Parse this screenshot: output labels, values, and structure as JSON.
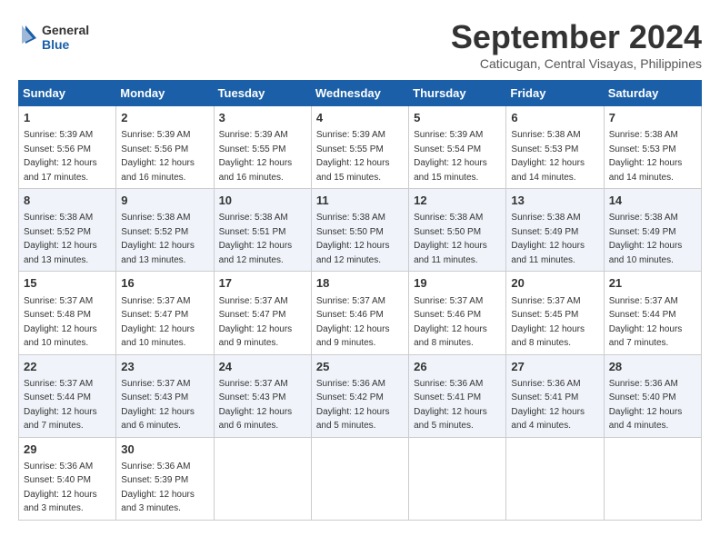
{
  "header": {
    "logo_line1": "General",
    "logo_line2": "Blue",
    "month": "September 2024",
    "location": "Caticugan, Central Visayas, Philippines"
  },
  "weekdays": [
    "Sunday",
    "Monday",
    "Tuesday",
    "Wednesday",
    "Thursday",
    "Friday",
    "Saturday"
  ],
  "weeks": [
    [
      {
        "day": "1",
        "sunrise": "Sunrise: 5:39 AM",
        "sunset": "Sunset: 5:56 PM",
        "daylight": "Daylight: 12 hours and 17 minutes."
      },
      {
        "day": "2",
        "sunrise": "Sunrise: 5:39 AM",
        "sunset": "Sunset: 5:56 PM",
        "daylight": "Daylight: 12 hours and 16 minutes."
      },
      {
        "day": "3",
        "sunrise": "Sunrise: 5:39 AM",
        "sunset": "Sunset: 5:55 PM",
        "daylight": "Daylight: 12 hours and 16 minutes."
      },
      {
        "day": "4",
        "sunrise": "Sunrise: 5:39 AM",
        "sunset": "Sunset: 5:55 PM",
        "daylight": "Daylight: 12 hours and 15 minutes."
      },
      {
        "day": "5",
        "sunrise": "Sunrise: 5:39 AM",
        "sunset": "Sunset: 5:54 PM",
        "daylight": "Daylight: 12 hours and 15 minutes."
      },
      {
        "day": "6",
        "sunrise": "Sunrise: 5:38 AM",
        "sunset": "Sunset: 5:53 PM",
        "daylight": "Daylight: 12 hours and 14 minutes."
      },
      {
        "day": "7",
        "sunrise": "Sunrise: 5:38 AM",
        "sunset": "Sunset: 5:53 PM",
        "daylight": "Daylight: 12 hours and 14 minutes."
      }
    ],
    [
      {
        "day": "8",
        "sunrise": "Sunrise: 5:38 AM",
        "sunset": "Sunset: 5:52 PM",
        "daylight": "Daylight: 12 hours and 13 minutes."
      },
      {
        "day": "9",
        "sunrise": "Sunrise: 5:38 AM",
        "sunset": "Sunset: 5:52 PM",
        "daylight": "Daylight: 12 hours and 13 minutes."
      },
      {
        "day": "10",
        "sunrise": "Sunrise: 5:38 AM",
        "sunset": "Sunset: 5:51 PM",
        "daylight": "Daylight: 12 hours and 12 minutes."
      },
      {
        "day": "11",
        "sunrise": "Sunrise: 5:38 AM",
        "sunset": "Sunset: 5:50 PM",
        "daylight": "Daylight: 12 hours and 12 minutes."
      },
      {
        "day": "12",
        "sunrise": "Sunrise: 5:38 AM",
        "sunset": "Sunset: 5:50 PM",
        "daylight": "Daylight: 12 hours and 11 minutes."
      },
      {
        "day": "13",
        "sunrise": "Sunrise: 5:38 AM",
        "sunset": "Sunset: 5:49 PM",
        "daylight": "Daylight: 12 hours and 11 minutes."
      },
      {
        "day": "14",
        "sunrise": "Sunrise: 5:38 AM",
        "sunset": "Sunset: 5:49 PM",
        "daylight": "Daylight: 12 hours and 10 minutes."
      }
    ],
    [
      {
        "day": "15",
        "sunrise": "Sunrise: 5:37 AM",
        "sunset": "Sunset: 5:48 PM",
        "daylight": "Daylight: 12 hours and 10 minutes."
      },
      {
        "day": "16",
        "sunrise": "Sunrise: 5:37 AM",
        "sunset": "Sunset: 5:47 PM",
        "daylight": "Daylight: 12 hours and 10 minutes."
      },
      {
        "day": "17",
        "sunrise": "Sunrise: 5:37 AM",
        "sunset": "Sunset: 5:47 PM",
        "daylight": "Daylight: 12 hours and 9 minutes."
      },
      {
        "day": "18",
        "sunrise": "Sunrise: 5:37 AM",
        "sunset": "Sunset: 5:46 PM",
        "daylight": "Daylight: 12 hours and 9 minutes."
      },
      {
        "day": "19",
        "sunrise": "Sunrise: 5:37 AM",
        "sunset": "Sunset: 5:46 PM",
        "daylight": "Daylight: 12 hours and 8 minutes."
      },
      {
        "day": "20",
        "sunrise": "Sunrise: 5:37 AM",
        "sunset": "Sunset: 5:45 PM",
        "daylight": "Daylight: 12 hours and 8 minutes."
      },
      {
        "day": "21",
        "sunrise": "Sunrise: 5:37 AM",
        "sunset": "Sunset: 5:44 PM",
        "daylight": "Daylight: 12 hours and 7 minutes."
      }
    ],
    [
      {
        "day": "22",
        "sunrise": "Sunrise: 5:37 AM",
        "sunset": "Sunset: 5:44 PM",
        "daylight": "Daylight: 12 hours and 7 minutes."
      },
      {
        "day": "23",
        "sunrise": "Sunrise: 5:37 AM",
        "sunset": "Sunset: 5:43 PM",
        "daylight": "Daylight: 12 hours and 6 minutes."
      },
      {
        "day": "24",
        "sunrise": "Sunrise: 5:37 AM",
        "sunset": "Sunset: 5:43 PM",
        "daylight": "Daylight: 12 hours and 6 minutes."
      },
      {
        "day": "25",
        "sunrise": "Sunrise: 5:36 AM",
        "sunset": "Sunset: 5:42 PM",
        "daylight": "Daylight: 12 hours and 5 minutes."
      },
      {
        "day": "26",
        "sunrise": "Sunrise: 5:36 AM",
        "sunset": "Sunset: 5:41 PM",
        "daylight": "Daylight: 12 hours and 5 minutes."
      },
      {
        "day": "27",
        "sunrise": "Sunrise: 5:36 AM",
        "sunset": "Sunset: 5:41 PM",
        "daylight": "Daylight: 12 hours and 4 minutes."
      },
      {
        "day": "28",
        "sunrise": "Sunrise: 5:36 AM",
        "sunset": "Sunset: 5:40 PM",
        "daylight": "Daylight: 12 hours and 4 minutes."
      }
    ],
    [
      {
        "day": "29",
        "sunrise": "Sunrise: 5:36 AM",
        "sunset": "Sunset: 5:40 PM",
        "daylight": "Daylight: 12 hours and 3 minutes."
      },
      {
        "day": "30",
        "sunrise": "Sunrise: 5:36 AM",
        "sunset": "Sunset: 5:39 PM",
        "daylight": "Daylight: 12 hours and 3 minutes."
      },
      null,
      null,
      null,
      null,
      null
    ]
  ]
}
